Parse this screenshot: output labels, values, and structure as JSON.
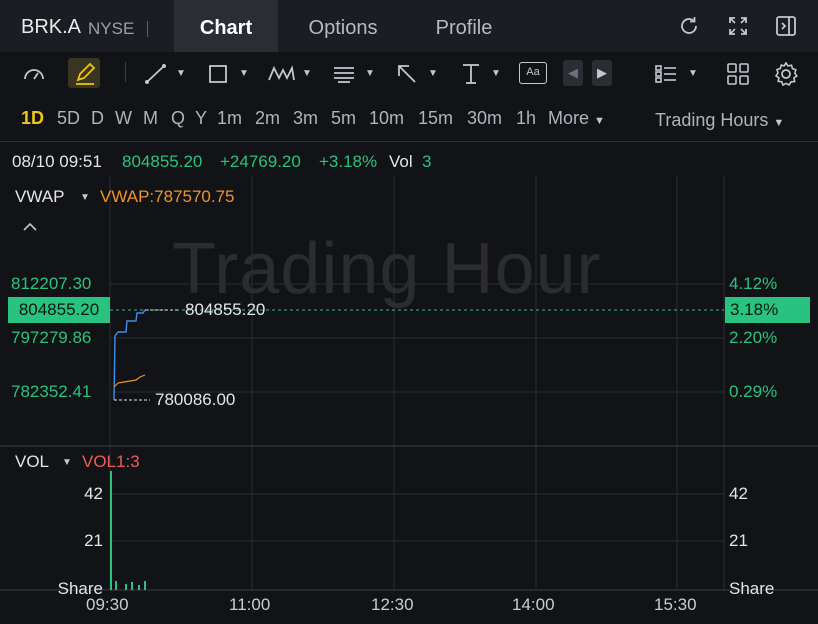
{
  "header": {
    "symbol": "BRK.A",
    "exchange": "NYSE",
    "tabs": [
      {
        "label": "Chart",
        "active": true
      },
      {
        "label": "Options",
        "active": false
      },
      {
        "label": "Profile",
        "active": false
      }
    ],
    "icons": [
      "refresh-icon",
      "expand-icon",
      "sidebar-toggle-icon"
    ]
  },
  "toolbar": {
    "tools": [
      "indicator-gauge-icon",
      "draw-pencil-icon",
      "trend-line-icon",
      "rectangle-icon",
      "pattern-icon",
      "fibonacci-icon",
      "arrow-icon",
      "measure-icon",
      "text-annotation-icon",
      "prev-icon",
      "next-icon",
      "layout-icon",
      "grid-icon",
      "settings-icon"
    ],
    "text_tool_label": "Aa"
  },
  "intervals": {
    "items": [
      "1D",
      "5D",
      "D",
      "W",
      "M",
      "Q",
      "Y",
      "1m",
      "2m",
      "3m",
      "5m",
      "10m",
      "15m",
      "30m",
      "1h"
    ],
    "active": "1D",
    "more_label": "More",
    "session_label": "Trading Hours"
  },
  "quote": {
    "datetime": "08/10 09:51",
    "price": "804855.20",
    "change": "+24769.20",
    "change_pct": "+3.18%",
    "vol_label": "Vol",
    "vol_value": "3"
  },
  "main_pane": {
    "indicator": "VWAP",
    "indicator_value": "VWAP:787570.75",
    "watermark": "Trading Hour",
    "price_labels": [
      "812207.30",
      "797279.86",
      "782352.41"
    ],
    "current_price_badge": "804855.20",
    "pct_labels": [
      "4.12%",
      "2.20%",
      "0.29%"
    ],
    "current_pct_badge": "3.18%",
    "high_marker": "804855.20",
    "low_marker": "780086.00",
    "colors": {
      "up": "#29c27f",
      "vwap": "#f0932b",
      "price_line": "#3d8ee8"
    }
  },
  "volume_pane": {
    "indicator": "VOL",
    "indicator_value": "VOL1:3",
    "left_labels": [
      "42",
      "21",
      "Share"
    ],
    "right_labels": [
      "42",
      "21",
      "Share"
    ]
  },
  "x_axis": [
    "09:30",
    "11:00",
    "12:30",
    "14:00",
    "15:30"
  ]
}
